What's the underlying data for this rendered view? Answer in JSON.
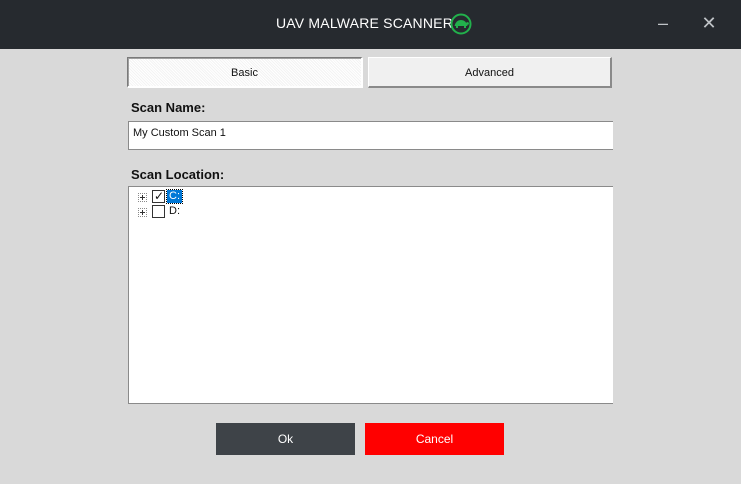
{
  "window": {
    "title": "UAV MALWARE SCANNER",
    "minimize_glyph": "–",
    "close_glyph": "✕",
    "logo_icon": "turtle-shell-icon",
    "logo_color": "#22b14c"
  },
  "tabs": [
    {
      "label": "Basic",
      "selected": true
    },
    {
      "label": "Advanced",
      "selected": false
    }
  ],
  "scan_name": {
    "label": "Scan Name:",
    "value": "My Custom Scan 1"
  },
  "scan_location": {
    "label": "Scan Location:",
    "items": [
      {
        "label": "C:",
        "checked": true,
        "selected": true
      },
      {
        "label": "D:",
        "checked": false,
        "selected": false
      }
    ]
  },
  "buttons": {
    "ok": "Ok",
    "cancel": "Cancel"
  },
  "colors": {
    "titlebar": "#262a2f",
    "background": "#d9d9d9",
    "ok_button": "#3e4348",
    "cancel_button": "#ff0000",
    "selection": "#0078d7"
  }
}
